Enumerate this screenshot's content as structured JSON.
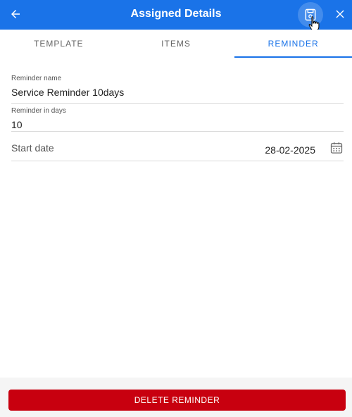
{
  "header": {
    "title": "Assigned Details",
    "back_icon": "arrow-left-icon",
    "save_icon": "save-icon",
    "close_icon": "close-icon",
    "color": "#1a73e8"
  },
  "tabs": [
    {
      "label": "TEMPLATE",
      "active": false
    },
    {
      "label": "ITEMS",
      "active": false
    },
    {
      "label": "REMINDER",
      "active": true
    }
  ],
  "form": {
    "reminder_name": {
      "label": "Reminder name",
      "value": "Service Reminder 10days"
    },
    "reminder_days": {
      "label": "Reminder in days",
      "value": "10"
    },
    "start_date": {
      "label": "Start date",
      "value": "28-02-2025",
      "icon": "calendar-icon"
    }
  },
  "footer": {
    "delete_label": "DELETE REMINDER",
    "delete_color": "#c8000f"
  }
}
